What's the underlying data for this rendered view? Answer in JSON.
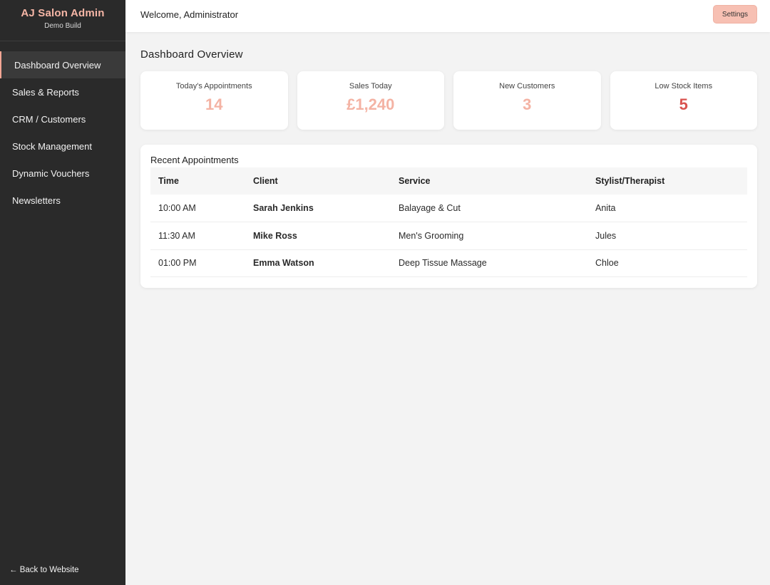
{
  "brand": {
    "title": "AJ Salon Admin",
    "subtitle": "Demo Build"
  },
  "sidebar": {
    "items": [
      {
        "label": "Dashboard Overview",
        "active": true
      },
      {
        "label": "Sales & Reports"
      },
      {
        "label": "CRM / Customers"
      },
      {
        "label": "Stock Management"
      },
      {
        "label": "Dynamic Vouchers"
      },
      {
        "label": "Newsletters"
      }
    ],
    "back_label": "← Back to Website"
  },
  "topbar": {
    "welcome": "Welcome, Administrator",
    "settings_label": "Settings"
  },
  "main": {
    "title": "Dashboard Overview",
    "cards": [
      {
        "label": "Today's Appointments",
        "value": "14",
        "color": "#f4b3a4"
      },
      {
        "label": "Sales Today",
        "value": "£1,240",
        "color": "#f4b3a4"
      },
      {
        "label": "New Customers",
        "value": "3",
        "color": "#f4b3a4"
      },
      {
        "label": "Low Stock Items",
        "value": "5",
        "color": "#d9534f"
      }
    ],
    "appointments": {
      "title": "Recent Appointments",
      "headers": [
        "Time",
        "Client",
        "Service",
        "Stylist/Therapist"
      ],
      "rows": [
        [
          "10:00 AM",
          "Sarah Jenkins",
          "Balayage & Cut",
          "Anita"
        ],
        [
          "11:30 AM",
          "Mike Ross",
          "Men's Grooming",
          "Jules"
        ],
        [
          "01:00 PM",
          "Emma Watson",
          "Deep Tissue Massage",
          "Chloe"
        ]
      ]
    }
  },
  "colors": {
    "accent": "#f4b3a4",
    "sidebar_bg": "#2a2a2a",
    "alert": "#d9534f"
  }
}
